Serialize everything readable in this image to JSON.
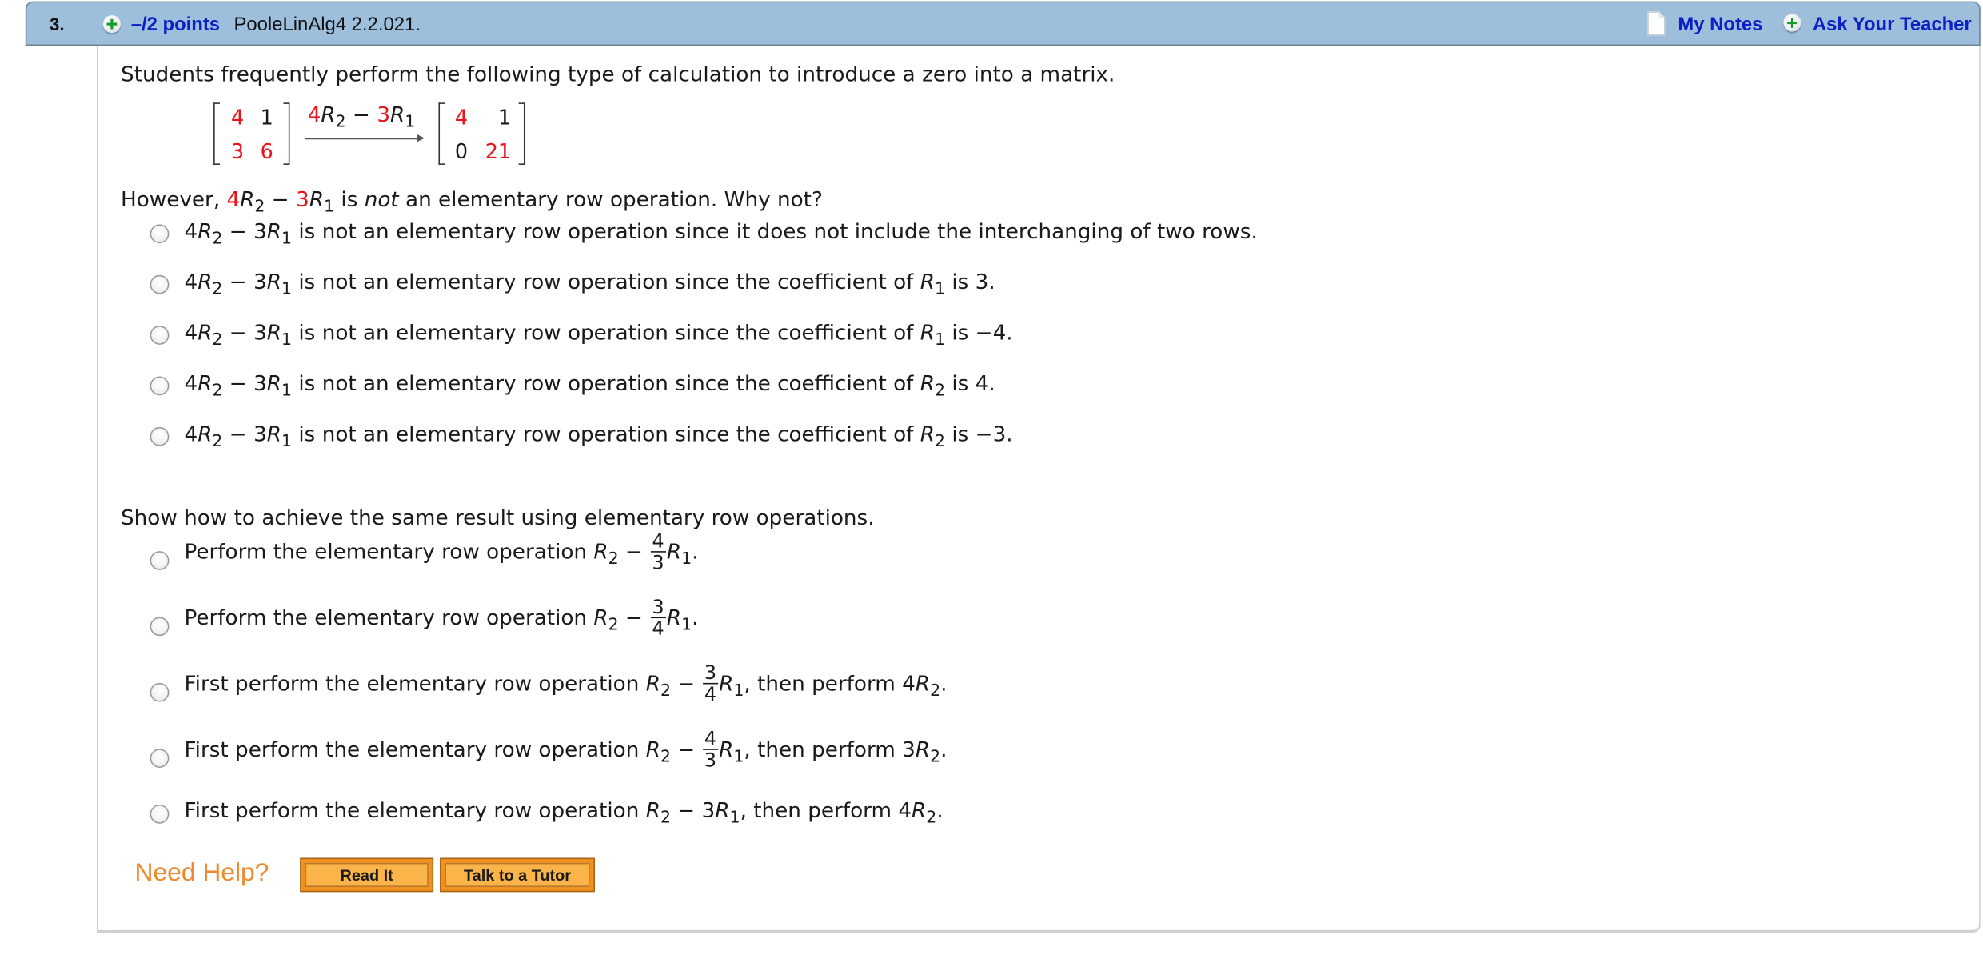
{
  "header": {
    "question_number": "3.",
    "points": "–/2 points",
    "question_id": "PooleLinAlg4 2.2.021.",
    "my_notes": "My Notes",
    "ask_teacher": "Ask Your Teacher",
    "background_color": "#9dbfdc",
    "link_color": "#0a1fc4"
  },
  "intro": "Students frequently perform the following type of calculation to introduce a zero into a matrix.",
  "matrix_before": [
    [
      "4",
      "1"
    ],
    [
      "3",
      "6"
    ]
  ],
  "matrix_after": [
    [
      "4",
      "1"
    ],
    [
      "0",
      "21"
    ]
  ],
  "operation": {
    "coef2": "4",
    "row2": "R",
    "sub2": "2",
    "minus": " − ",
    "coef1": "3",
    "row1": "R",
    "sub1": "1"
  },
  "highlight_color": "#e8141b",
  "question1": {
    "prefix": "However, ",
    "middle": " is ",
    "emph": "not",
    "suffix": " an elementary row operation. Why not?",
    "options": [
      {
        "head": "4R",
        "s1": "2",
        "mid": " − 3R",
        "s2": "1",
        "text": " is not an elementary row operation since it does not include the interchanging of two rows.",
        "tail_var": "",
        "tail_sub": "",
        "tail_end": ""
      },
      {
        "head": "4R",
        "s1": "2",
        "mid": " − 3R",
        "s2": "1",
        "text": " is not an elementary row operation since the coefficient of ",
        "tail_var": "R",
        "tail_sub": "1",
        "tail_end": " is 3."
      },
      {
        "head": "4R",
        "s1": "2",
        "mid": " − 3R",
        "s2": "1",
        "text": " is not an elementary row operation since the coefficient of ",
        "tail_var": "R",
        "tail_sub": "1",
        "tail_end": " is −4."
      },
      {
        "head": "4R",
        "s1": "2",
        "mid": " − 3R",
        "s2": "1",
        "text": " is not an elementary row operation since the coefficient of ",
        "tail_var": "R",
        "tail_sub": "2",
        "tail_end": " is 4."
      },
      {
        "head": "4R",
        "s1": "2",
        "mid": " − 3R",
        "s2": "1",
        "text": " is not an elementary row operation since the coefficient of ",
        "tail_var": "R",
        "tail_sub": "2",
        "tail_end": " is −3."
      }
    ]
  },
  "question2": {
    "prompt": "Show how to achieve the same result using elementary row operations.",
    "options": [
      {
        "lead": "Perform the elementary row operation ",
        "r": "R",
        "rs": "2",
        "minus": " − ",
        "num": "4",
        "den": "3",
        "r1": "R",
        "r1s": "1",
        "tail": ".",
        "t2": "",
        "t2s": "",
        "end": ""
      },
      {
        "lead": "Perform the elementary row operation ",
        "r": "R",
        "rs": "2",
        "minus": " − ",
        "num": "3",
        "den": "4",
        "r1": "R",
        "r1s": "1",
        "tail": ".",
        "t2": "",
        "t2s": "",
        "end": ""
      },
      {
        "lead": "First perform the elementary row operation ",
        "r": "R",
        "rs": "2",
        "minus": " − ",
        "num": "3",
        "den": "4",
        "r1": "R",
        "r1s": "1",
        "tail": ", then perform 4",
        "t2": "R",
        "t2s": "2",
        "end": "."
      },
      {
        "lead": "First perform the elementary row operation ",
        "r": "R",
        "rs": "2",
        "minus": " − ",
        "num": "4",
        "den": "3",
        "r1": "R",
        "r1s": "1",
        "tail": ", then perform 3",
        "t2": "R",
        "t2s": "2",
        "end": "."
      },
      {
        "lead": "First perform the elementary row operation ",
        "r": "R",
        "rs": "2",
        "minus": " − 3",
        "num": "",
        "den": "",
        "r1": "R",
        "r1s": "1",
        "tail": ", then perform 4",
        "t2": "R",
        "t2s": "2",
        "end": "."
      }
    ]
  },
  "help": {
    "label": "Need Help?",
    "read_it": "Read It",
    "talk_tutor": "Talk to a Tutor",
    "accent_color": "#ef8a2c"
  }
}
